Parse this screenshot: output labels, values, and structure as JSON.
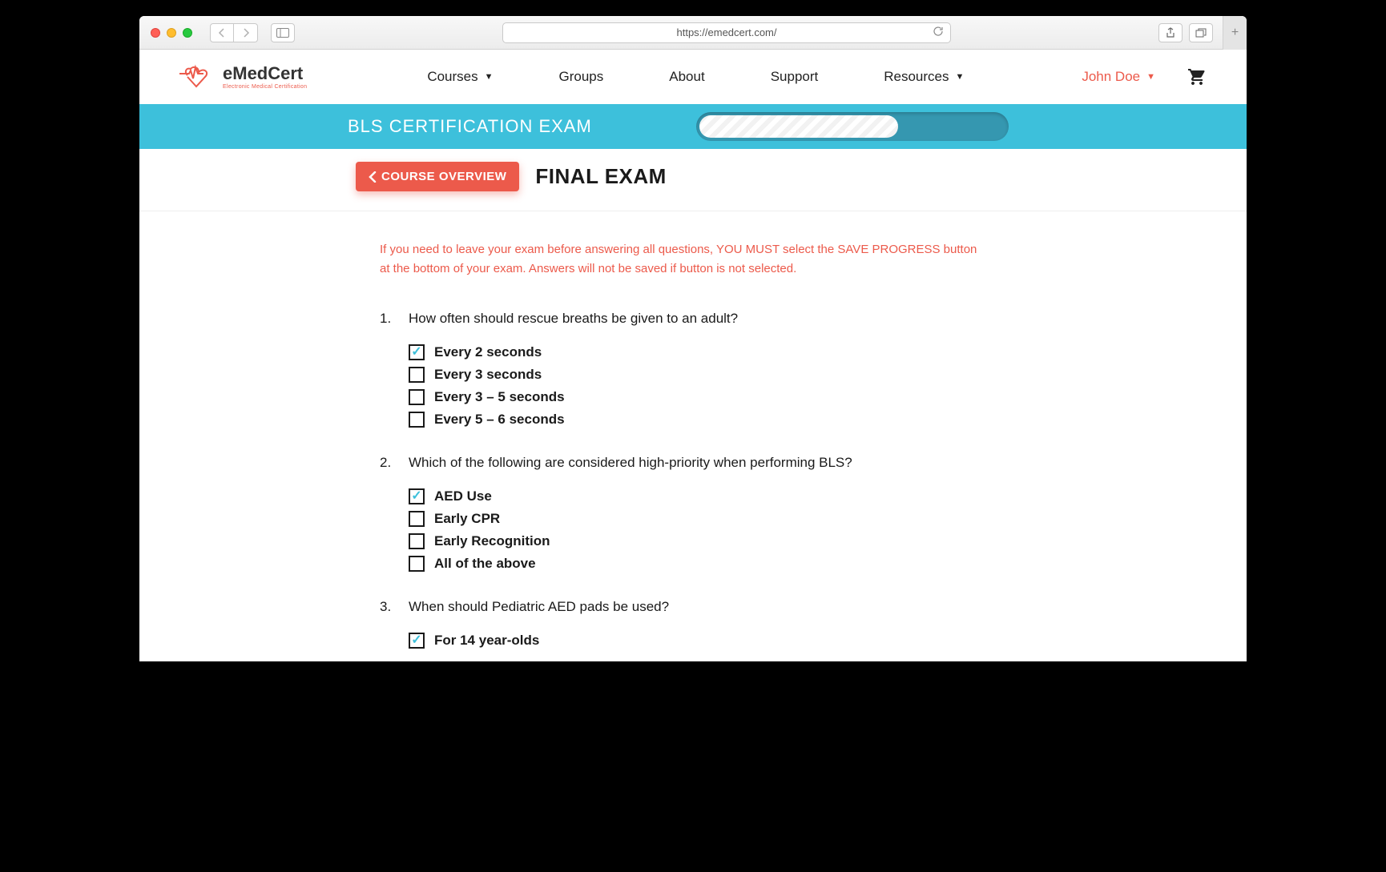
{
  "browser": {
    "url": "https://emedcert.com/"
  },
  "logo": {
    "brand_prefix": "e",
    "brand_main": "MedCert",
    "tagline": "Electronic Medical Certification"
  },
  "nav": {
    "items": [
      {
        "label": "Courses",
        "has_dropdown": true
      },
      {
        "label": "Groups",
        "has_dropdown": false
      },
      {
        "label": "About",
        "has_dropdown": false
      },
      {
        "label": "Support",
        "has_dropdown": false
      },
      {
        "label": "Resources",
        "has_dropdown": true
      }
    ],
    "user_name": "John Doe"
  },
  "banner": {
    "title": "BLS CERTIFICATION EXAM"
  },
  "sub_header": {
    "back_label": "COURSE OVERVIEW",
    "page_title": "FINAL EXAM"
  },
  "warning": "If you need to leave your exam before answering all questions, YOU MUST select the SAVE PROGRESS button at the bottom of your exam. Answers will not be saved if button is not selected.",
  "questions": [
    {
      "number": "1.",
      "text": "How often should rescue breaths be given to an adult?",
      "options": [
        {
          "label": "Every 2 seconds",
          "checked": true
        },
        {
          "label": "Every 3 seconds",
          "checked": false
        },
        {
          "label": "Every 3 – 5 seconds",
          "checked": false
        },
        {
          "label": "Every 5 – 6 seconds",
          "checked": false
        }
      ]
    },
    {
      "number": "2.",
      "text": "Which of the following are considered high-priority when performing BLS?",
      "options": [
        {
          "label": "AED Use",
          "checked": true
        },
        {
          "label": "Early CPR",
          "checked": false
        },
        {
          "label": "Early Recognition",
          "checked": false
        },
        {
          "label": "All of the above",
          "checked": false
        }
      ]
    },
    {
      "number": "3.",
      "text": "When should Pediatric AED pads be used?",
      "options": [
        {
          "label": "For 14 year-olds",
          "checked": true
        }
      ]
    }
  ]
}
